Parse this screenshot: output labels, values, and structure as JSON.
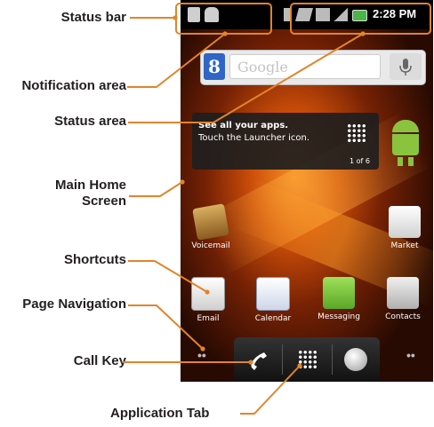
{
  "labels": {
    "status_bar": "Status bar",
    "notification_area": "Notification area",
    "status_area": "Status area",
    "main_home_1": "Main Home",
    "main_home_2": "Screen",
    "shortcuts": "Shortcuts",
    "page_navigation": "Page Navigation",
    "call_key": "Call Key",
    "application_tab": "Application Tab"
  },
  "phone": {
    "time": "2:28 PM",
    "search_placeholder": "Google",
    "tip_line1": "See all your apps.",
    "tip_line2": "Touch the Launcher icon.",
    "tip_page": "1 of 6",
    "apps": {
      "voicemail": "Voicemail",
      "market": "Market",
      "email": "Email",
      "calendar": "Calendar",
      "messaging": "Messaging",
      "contacts": "Contacts"
    },
    "page_dots_left": "••",
    "page_dots_right": "••"
  },
  "colors": {
    "callout_line": "#e2842a",
    "battery": "#48b648"
  }
}
